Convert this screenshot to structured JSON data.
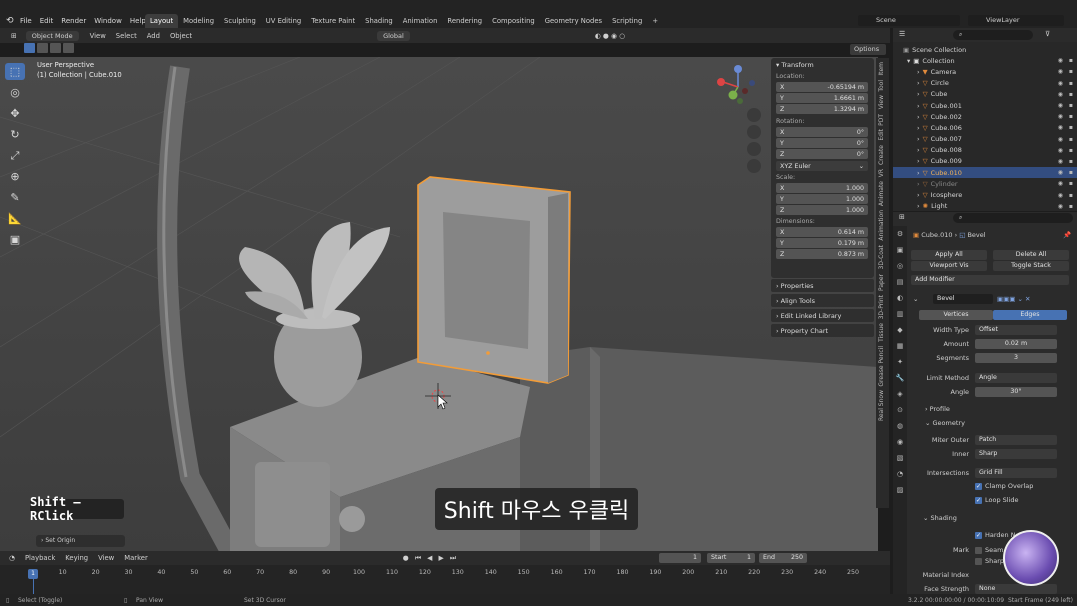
{
  "topbar": {
    "menus": [
      "File",
      "Edit",
      "Render",
      "Window",
      "Help"
    ],
    "workspaces": [
      "Layout",
      "Modeling",
      "Sculpting",
      "UV Editing",
      "Texture Paint",
      "Shading",
      "Animation",
      "Rendering",
      "Compositing",
      "Geometry Nodes",
      "Scripting"
    ],
    "add_tab": "+",
    "scene": "Scene",
    "view_layer": "ViewLayer"
  },
  "header": {
    "mode": "Object Mode",
    "menus": [
      "View",
      "Select",
      "Add",
      "Object"
    ],
    "orientation": "Global",
    "options": "Options"
  },
  "viewport": {
    "perspective": "User Perspective",
    "collection_info": "(1) Collection | Cube.010"
  },
  "npanel": {
    "title": "Transform",
    "location_label": "Location:",
    "location": [
      {
        "axis": "X",
        "value": "-0.65194 m"
      },
      {
        "axis": "Y",
        "value": "1.6661 m"
      },
      {
        "axis": "Z",
        "value": "1.3294 m"
      }
    ],
    "rotation_label": "Rotation:",
    "rotation": [
      {
        "axis": "X",
        "value": "0°"
      },
      {
        "axis": "Y",
        "value": "0°"
      },
      {
        "axis": "Z",
        "value": "0°"
      }
    ],
    "rotation_mode": "XYZ Euler",
    "scale_label": "Scale:",
    "scale": [
      {
        "axis": "X",
        "value": "1.000"
      },
      {
        "axis": "Y",
        "value": "1.000"
      },
      {
        "axis": "Z",
        "value": "1.000"
      }
    ],
    "dimensions_label": "Dimensions:",
    "dimensions": [
      {
        "axis": "X",
        "value": "0.614 m"
      },
      {
        "axis": "Y",
        "value": "0.179 m"
      },
      {
        "axis": "Z",
        "value": "0.873 m"
      }
    ],
    "sections": [
      "Properties",
      "Align Tools",
      "Edit Linked Library",
      "Property Chart"
    ]
  },
  "vtabs": [
    "Item",
    "Tool",
    "View",
    "PDT",
    "Edit",
    "Create",
    "VR",
    "Animate",
    "Animation",
    "3D-Coat",
    "Paper",
    "3D-Print",
    "Tissue",
    "Grease Pencil",
    "Real Snow"
  ],
  "outliner": {
    "root": "Scene Collection",
    "collection": "Collection",
    "items": [
      "Camera",
      "Circle",
      "Cube",
      "Cube.001",
      "Cube.002",
      "Cube.006",
      "Cube.007",
      "Cube.008",
      "Cube.009",
      "Cube.010",
      "Cylinder",
      "Icosphere",
      "Light"
    ],
    "selected": "Cube.010"
  },
  "properties": {
    "breadcrumb_obj": "Cube.010",
    "breadcrumb_mod": "Bevel",
    "apply_all": "Apply All",
    "delete_all": "Delete All",
    "viewport_vis": "Viewport Vis",
    "toggle_stack": "Toggle Stack",
    "add_modifier": "Add Modifier",
    "modifier_name": "Bevel",
    "tab_vertices": "Vertices",
    "tab_edges": "Edges",
    "width_type_label": "Width Type",
    "width_type": "Offset",
    "amount_label": "Amount",
    "amount": "0.02 m",
    "segments_label": "Segments",
    "segments": "3",
    "limit_method_label": "Limit Method",
    "limit_method": "Angle",
    "angle_label": "Angle",
    "angle": "30°",
    "profile": "Profile",
    "geometry": "Geometry",
    "miter_outer_label": "Miter Outer",
    "miter_outer": "Patch",
    "inner_label": "Inner",
    "inner": "Sharp",
    "intersections_label": "Intersections",
    "intersections": "Grid Fill",
    "clamp_overlap": "Clamp Overlap",
    "loop_slide": "Loop Slide",
    "shading": "Shading",
    "harden_normals": "Harden Norm",
    "mark_label": "Mark",
    "seam": "Seam",
    "sharp": "Sharp",
    "material_index_label": "Material Index",
    "face_strength_label": "Face Strength",
    "face_strength": "None"
  },
  "timeline": {
    "menus": [
      "Playback",
      "Keying",
      "View",
      "Marker"
    ],
    "current_frame": "1",
    "start_label": "Start",
    "start": "1",
    "end_label": "End",
    "end": "250",
    "ticks": [
      "1",
      "10",
      "20",
      "30",
      "40",
      "50",
      "60",
      "70",
      "80",
      "90",
      "100",
      "110",
      "120",
      "130",
      "140",
      "150",
      "160",
      "170",
      "180",
      "190",
      "200",
      "210",
      "220",
      "230",
      "240",
      "250"
    ]
  },
  "statusbar": {
    "select": "Select (Toggle)",
    "pan": "Pan View",
    "cursor": "Set 3D Cursor",
    "version": "3.2.2",
    "time": "00:00:00:00 / 00:00:10:09",
    "start_frame": "Start Frame (249 left)"
  },
  "overlay": {
    "subtitle": "Shift 마우스 우클릭",
    "keycast": "Shift – RClick",
    "set_origin": "Set Origin"
  },
  "colors": {
    "selection": "#4772b3",
    "outline": "#f29c38",
    "accent_row": "#334d80"
  }
}
